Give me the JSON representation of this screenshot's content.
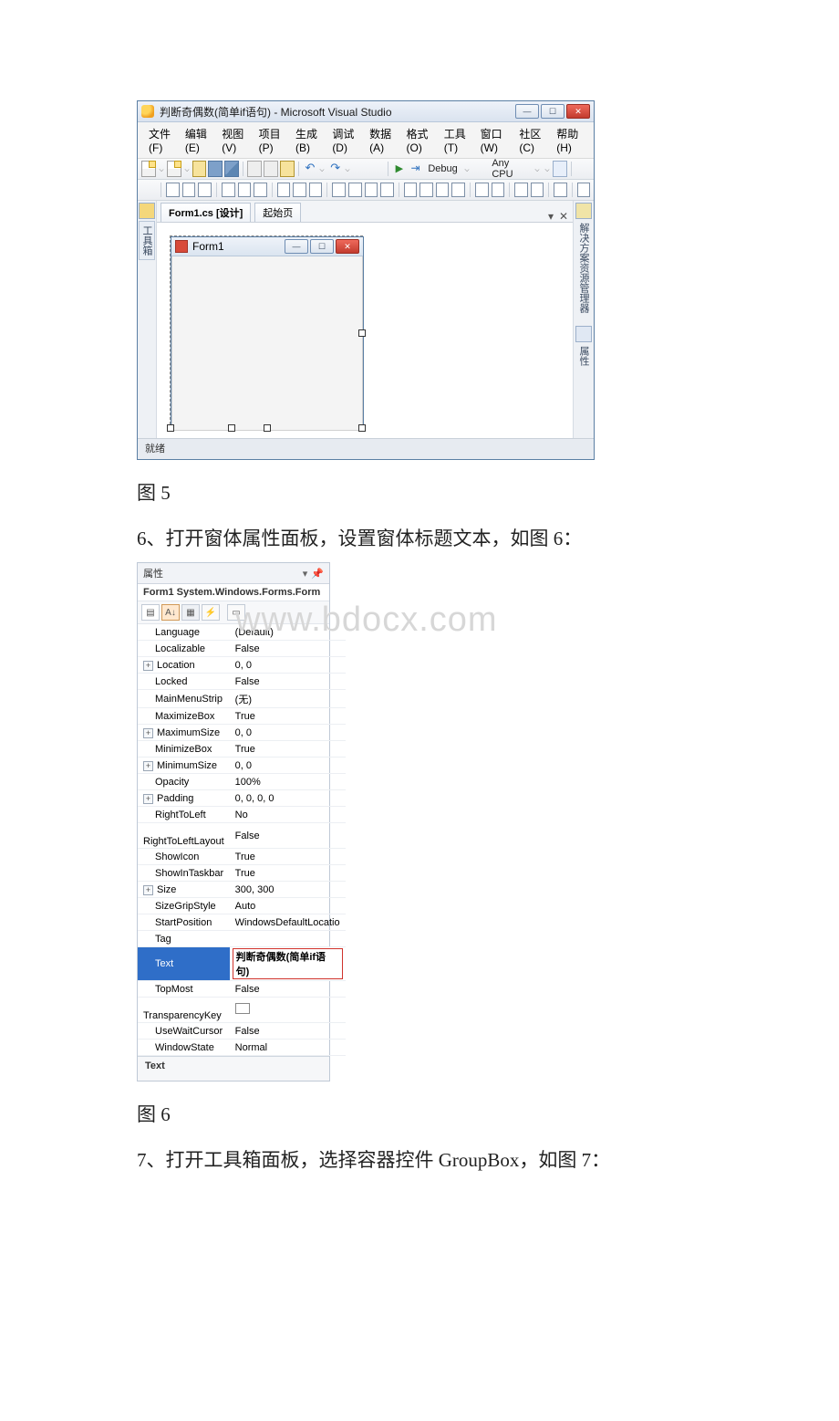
{
  "vs": {
    "title": "判断奇偶数(简单if语句) - Microsoft Visual Studio",
    "menu": [
      "文件(F)",
      "编辑(E)",
      "视图(V)",
      "项目(P)",
      "生成(B)",
      "调试(D)",
      "数据(A)",
      "格式(O)",
      "工具(T)",
      "窗口(W)",
      "社区(C)",
      "帮助(H)"
    ],
    "debug_label": "Debug",
    "config_label": "Any CPU",
    "tabs": {
      "design": "Form1.cs [设计]",
      "start": "起始页"
    },
    "form_title": "Form1",
    "left_dock": "工具箱",
    "right_sol": "解决方案资源管理器",
    "right_prop": "属性",
    "status": "就绪"
  },
  "caption_fig5": "图 5",
  "step6_text": "6、打开窗体属性面板，设置窗体标题文本，如图 6：",
  "properties": {
    "title": "属性",
    "object": "Form1 System.Windows.Forms.Form",
    "rows": [
      {
        "key": "Language",
        "val": "(Default)"
      },
      {
        "key": "Localizable",
        "val": "False"
      },
      {
        "key": "Location",
        "val": "0, 0",
        "exp": true
      },
      {
        "key": "Locked",
        "val": "False"
      },
      {
        "key": "MainMenuStrip",
        "val": "(无)"
      },
      {
        "key": "MaximizeBox",
        "val": "True"
      },
      {
        "key": "MaximumSize",
        "val": "0, 0",
        "exp": true
      },
      {
        "key": "MinimizeBox",
        "val": "True"
      },
      {
        "key": "MinimumSize",
        "val": "0, 0",
        "exp": true
      },
      {
        "key": "Opacity",
        "val": "100%"
      },
      {
        "key": "Padding",
        "val": "0, 0, 0, 0",
        "exp": true
      },
      {
        "key": "RightToLeft",
        "val": "No"
      },
      {
        "key": "RightToLeftLayout",
        "val": "False"
      },
      {
        "key": "ShowIcon",
        "val": "True"
      },
      {
        "key": "ShowInTaskbar",
        "val": "True"
      },
      {
        "key": "Size",
        "val": "300, 300",
        "exp": true
      },
      {
        "key": "SizeGripStyle",
        "val": "Auto"
      },
      {
        "key": "StartPosition",
        "val": "WindowsDefaultLocatio"
      },
      {
        "key": "Tag",
        "val": ""
      },
      {
        "key": "Text",
        "val": "判断奇偶数(简单if语句)",
        "selected": true,
        "boxed": true
      },
      {
        "key": "TopMost",
        "val": "False"
      },
      {
        "key": "TransparencyKey",
        "val": "",
        "swatch": true
      },
      {
        "key": "UseWaitCursor",
        "val": "False"
      },
      {
        "key": "WindowState",
        "val": "Normal"
      }
    ],
    "desc_label": "Text"
  },
  "watermark": "www.bdocx.com",
  "caption_fig6": "图 6",
  "step7_text": "7、打开工具箱面板，选择容器控件 GroupBox，如图 7："
}
